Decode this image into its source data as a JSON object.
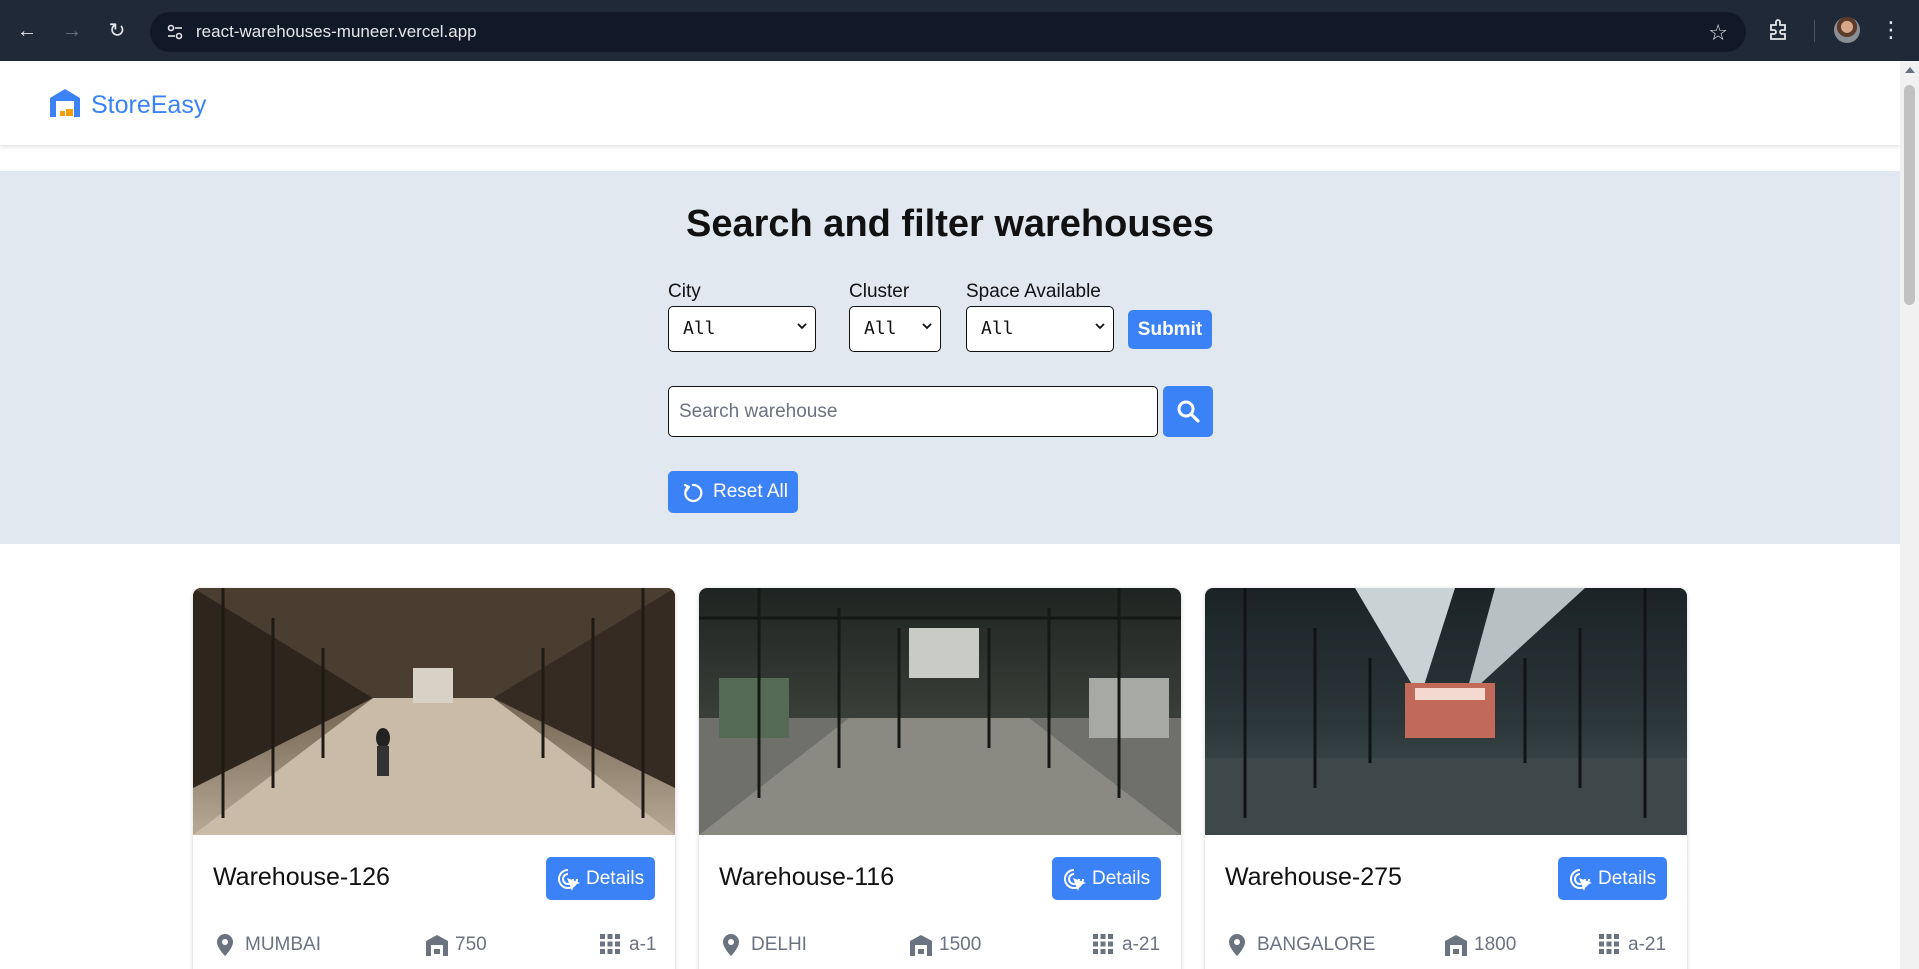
{
  "browser": {
    "url": "react-warehouses-muneer.vercel.app"
  },
  "header": {
    "brand": "StoreEasy"
  },
  "filters": {
    "title": "Search and filter warehouses",
    "city": {
      "label": "City",
      "value": "All"
    },
    "cluster": {
      "label": "Cluster",
      "value": "All"
    },
    "space": {
      "label": "Space Available",
      "value": "All"
    },
    "submit_label": "Submit",
    "search_placeholder": "Search warehouse",
    "reset_label": "Reset All"
  },
  "cards": [
    {
      "name": "Warehouse-126",
      "details_label": "Details",
      "city": "MUMBAI",
      "space": "750",
      "cluster": "a-1"
    },
    {
      "name": "Warehouse-116",
      "details_label": "Details",
      "city": "DELHI",
      "space": "1500",
      "cluster": "a-21"
    },
    {
      "name": "Warehouse-275",
      "details_label": "Details",
      "city": "BANGALORE",
      "space": "1800",
      "cluster": "a-21"
    }
  ],
  "colors": {
    "accent": "#3b82f6",
    "filter_bg": "#e2e8f0",
    "chrome_bg": "#1f2937"
  }
}
